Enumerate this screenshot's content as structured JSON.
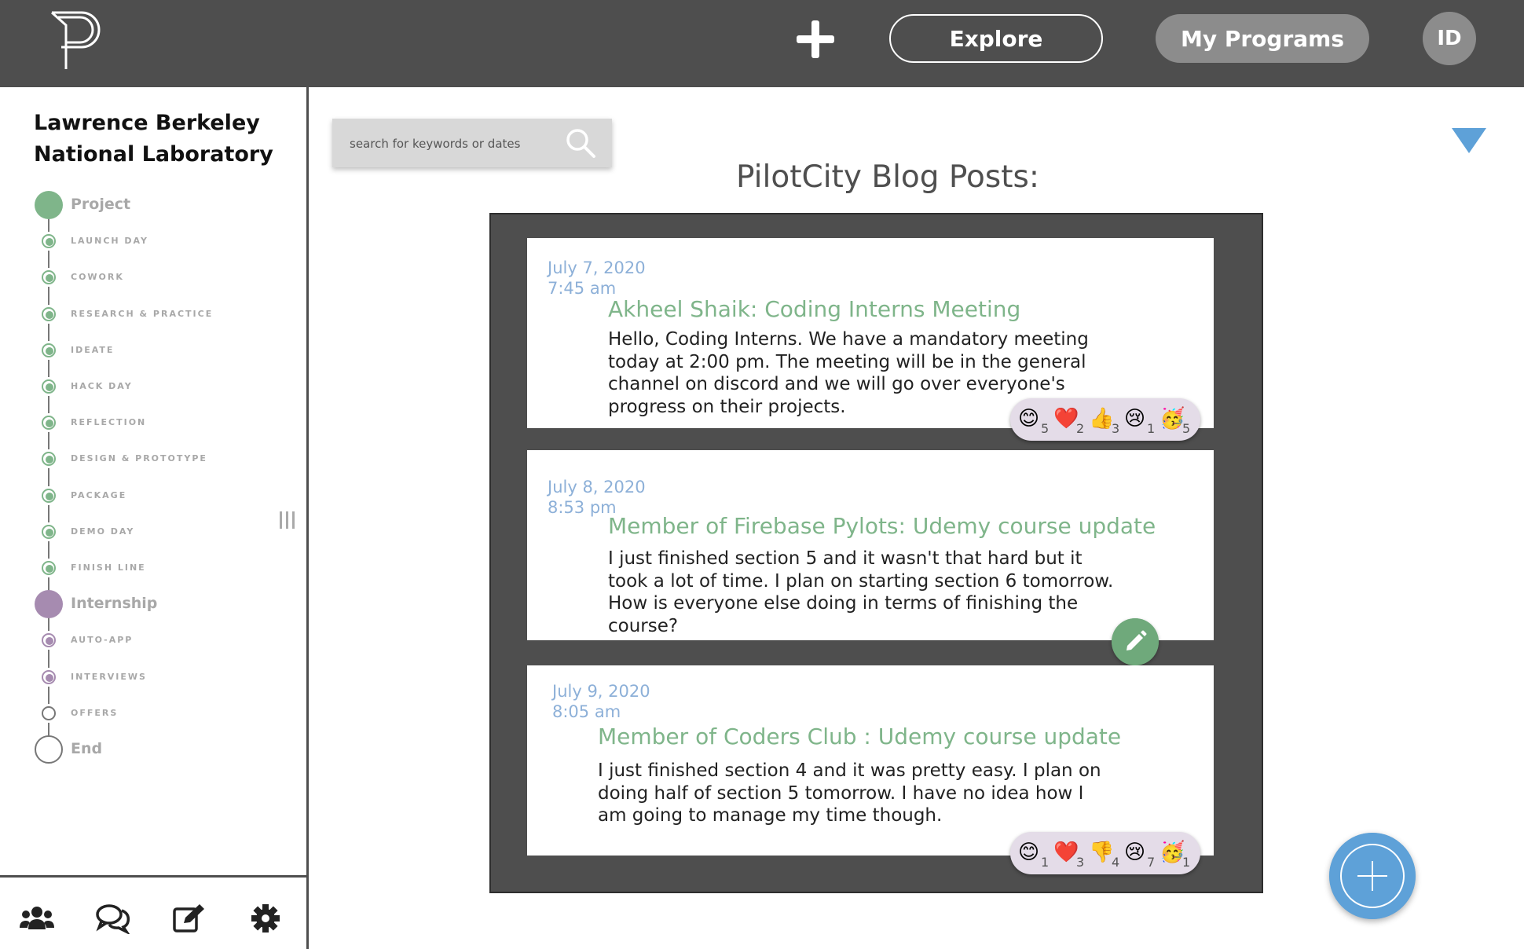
{
  "header": {
    "logo_icon": "pilotcity-logo-icon",
    "add_icon": "plus-icon",
    "explore_label": "Explore",
    "programs_label": "My Programs",
    "avatar_initials": "ID"
  },
  "sidebar": {
    "org_line1": "Lawrence Berkeley",
    "org_line2": "National Laboratory",
    "timeline": [
      {
        "label": "Project",
        "kind": "major",
        "status": "complete"
      },
      {
        "label": "LAUNCH DAY",
        "kind": "minor",
        "status": "complete"
      },
      {
        "label": "COWORK",
        "kind": "minor",
        "status": "complete"
      },
      {
        "label": "RESEARCH & PRACTICE",
        "kind": "minor",
        "status": "complete"
      },
      {
        "label": "IDEATE",
        "kind": "minor",
        "status": "complete"
      },
      {
        "label": "HACK DAY",
        "kind": "minor",
        "status": "complete"
      },
      {
        "label": "REFLECTION",
        "kind": "minor",
        "status": "complete"
      },
      {
        "label": "DESIGN & PROTOTYPE",
        "kind": "minor",
        "status": "complete"
      },
      {
        "label": "PACKAGE",
        "kind": "minor",
        "status": "complete"
      },
      {
        "label": "DEMO DAY",
        "kind": "minor",
        "status": "complete"
      },
      {
        "label": "FINISH LINE",
        "kind": "minor",
        "status": "complete"
      },
      {
        "label": "Internship",
        "kind": "major",
        "status": "active"
      },
      {
        "label": "AUTO-APP",
        "kind": "minor",
        "status": "active"
      },
      {
        "label": "INTERVIEWS",
        "kind": "minor",
        "status": "active"
      },
      {
        "label": "OFFERS",
        "kind": "minor",
        "status": "pending"
      },
      {
        "label": "End",
        "kind": "major",
        "status": "pending"
      }
    ],
    "bottom_nav": [
      "users-icon",
      "chat-icon",
      "edit-icon",
      "gear-icon"
    ]
  },
  "search": {
    "placeholder": "search for keywords or dates",
    "icon": "search-icon"
  },
  "feed": {
    "title": "PilotCity Blog Posts:",
    "posts": [
      {
        "date": "July 7, 2020",
        "time": "7:45 am",
        "title": "Akheel Shaik: Coding Interns Meeting",
        "body": "Hello, Coding Interns. We have a mandatory meeting today at 2:00 pm. The meeting will be in the general channel on discord and we will go over everyone's progress on their projects.",
        "reactions": [
          {
            "emoji": "😊",
            "icon": "smile-icon",
            "count": "5"
          },
          {
            "emoji": "❤️",
            "icon": "heart-icon",
            "count": "2"
          },
          {
            "emoji": "👍",
            "icon": "thumbs-up-icon",
            "count": "3"
          },
          {
            "emoji": "😢",
            "icon": "sad-icon",
            "count": "1"
          },
          {
            "emoji": "🥳",
            "icon": "party-icon",
            "count": "5"
          }
        ]
      },
      {
        "date": "July 8, 2020",
        "time": "8:53 pm",
        "title": "Member of Firebase Pylots: Udemy course update",
        "body": "I just finished section 5 and it wasn't that hard but it took a lot of time. I plan on starting section 6 tomorrow. How is everyone else doing in terms of finishing the course?",
        "reactions": []
      },
      {
        "date": "July 9, 2020",
        "time": "8:05 am",
        "title": "Member of Coders Club : Udemy course update",
        "body": "I just finished section 4 and it was pretty easy. I plan on doing half of section 5 tomorrow. I have no idea how I am going to manage my time though.",
        "reactions": [
          {
            "emoji": "😊",
            "icon": "smile-icon",
            "count": "1"
          },
          {
            "emoji": "❤️",
            "icon": "heart-icon",
            "count": "3"
          },
          {
            "emoji": "👎",
            "icon": "thumbs-down-icon",
            "count": "4"
          },
          {
            "emoji": "😢",
            "icon": "sad-icon",
            "count": "7"
          },
          {
            "emoji": "🥳",
            "icon": "party-icon",
            "count": "1"
          }
        ]
      }
    ]
  },
  "colors": {
    "topbar": "#4e4e4e",
    "project_green": "#7fb58a",
    "internship_purple": "#a68bb0",
    "date_blue": "#8db0d8",
    "accent_blue": "#5ea1d8"
  },
  "icons": {
    "edit": "pencil-icon",
    "fab": "add-post-icon",
    "filter": "triangle-down-icon",
    "collapse": "collapse-handle-icon"
  }
}
